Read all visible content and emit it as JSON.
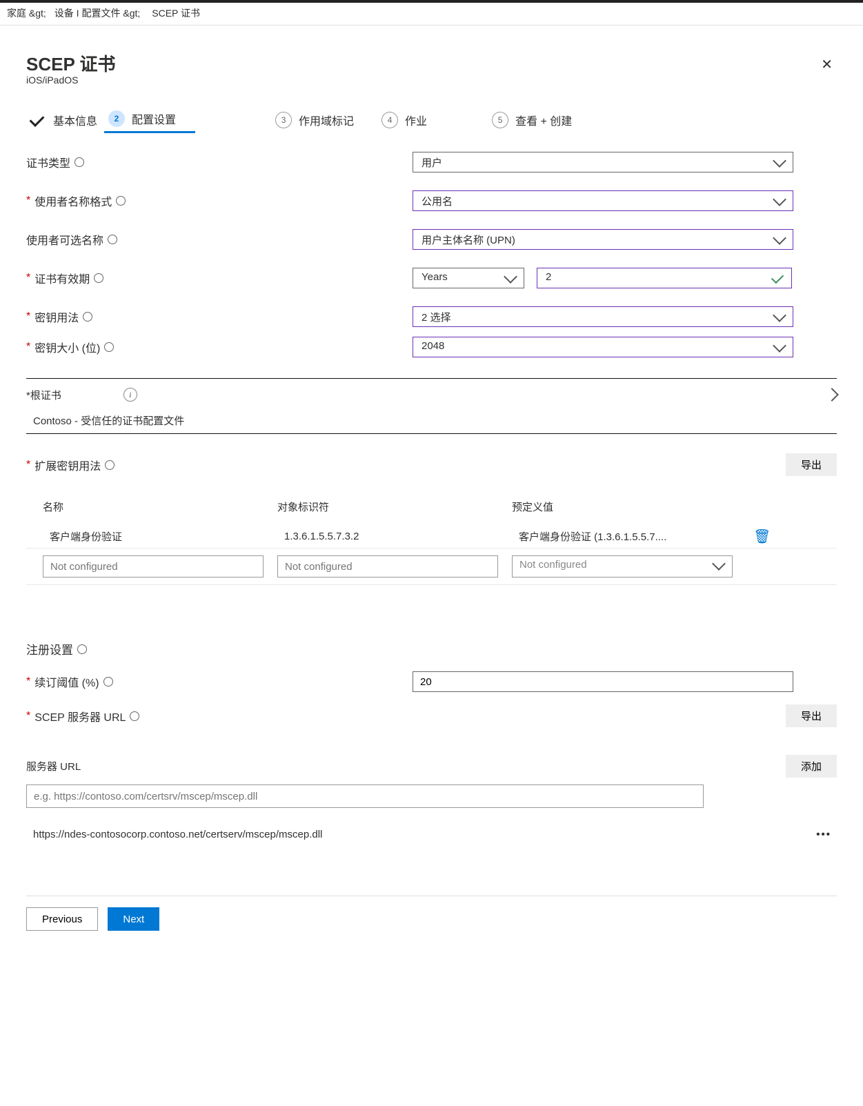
{
  "breadcrumb": {
    "home": "家庭 &gt;",
    "devices": "设备 I 配置文件 &gt;",
    "last": "SCEP 证书"
  },
  "header": {
    "title": "SCEP 证书",
    "subtitle": "iOS/iPadOS"
  },
  "steps": {
    "s1": "基本信息",
    "s2": "配置设置",
    "s3": "作用域标记",
    "s4": "作业",
    "s5": "查看 + 创建",
    "n2": "2",
    "n3": "3",
    "n4": "4",
    "n5": "5"
  },
  "form": {
    "cert_type_lbl": "证书类型",
    "cert_type_val": "用户",
    "snf_lbl": "使用者名称格式",
    "snf_val": "公用名",
    "san_lbl": "使用者可选名称",
    "san_val": "用户主体名称 (UPN)",
    "validity_lbl": "证书有效期",
    "validity_unit": "Years",
    "validity_val": "2",
    "keyuse_lbl": "密钥用法",
    "keyuse_val": "2 选择",
    "keysize_lbl": "密钥大小 (位)",
    "keysize_val": "2048",
    "root_lbl": "*根证书",
    "root_val": "Contoso - 受信任的证书配置文件",
    "eku_lbl": "扩展密钥用法",
    "export": "导出",
    "eku_cols": {
      "name": "名称",
      "oid": "对象标识符",
      "preset": "预定义值"
    },
    "eku_row": {
      "name": "客户端身份验证",
      "oid": "1.3.6.1.5.5.7.3.2",
      "preset": "客户端身份验证 (1.3.6.1.5.5.7....",
      "nc": "Not configured"
    },
    "reg_lbl": "注册设置",
    "renew_lbl": "续订阈值 (%)",
    "renew_val": "20",
    "scep_lbl": "SCEP 服务器 URL",
    "server_lbl": "服务器 URL",
    "add": "添加",
    "server_ph": "e.g. https://contoso.com/certsrv/mscep/mscep.dll",
    "server_url": "https://ndes-contosocorp.contoso.net/certserv/mscep/mscep.dll"
  },
  "footer": {
    "prev": "Previous",
    "next": "Next"
  }
}
